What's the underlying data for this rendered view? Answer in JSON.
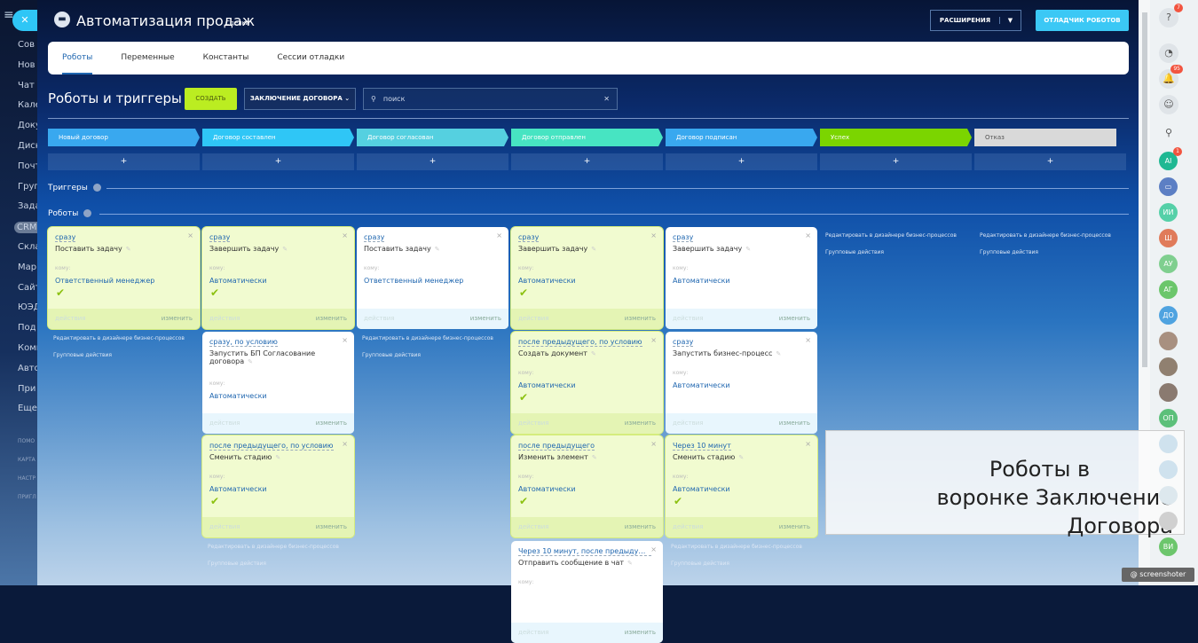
{
  "header": {
    "app_title": "Автоматизация продаж",
    "app_subtitle": "Сделки",
    "extensions_label": "РАСШИРЕНИЯ",
    "debug_label": "ОТЛАДЧИК РОБОТОВ"
  },
  "tabs": [
    "Роботы",
    "Переменные",
    "Константы",
    "Сессии отладки"
  ],
  "toolbar": {
    "title": "Роботы и триггеры",
    "create_label": "СОЗДАТЬ",
    "funnel_label": "ЗАКЛЮЧЕНИЕ ДОГОВОРА",
    "search_placeholder": "поиск"
  },
  "stages": [
    {
      "name": "Новый договор",
      "color": "#39a8ef"
    },
    {
      "name": "Договор составлен",
      "color": "#2fc6f6"
    },
    {
      "name": "Договор согласован",
      "color": "#55d0e0"
    },
    {
      "name": "Договор отправлен",
      "color": "#47e4c2"
    },
    {
      "name": "Договор подписан",
      "color": "#39a8ef"
    },
    {
      "name": "Успех",
      "color": "#7bd500"
    },
    {
      "name": "Отказ",
      "color": "#d9d9d9"
    }
  ],
  "add_label": "+",
  "sections": {
    "triggers": "Триггеры",
    "robots": "Роботы"
  },
  "card_labels": {
    "to": "кому:",
    "actions": "действия",
    "edit": "изменить"
  },
  "link_labels": {
    "designer": "Редактировать в дизайнере бизнес-процессов",
    "group": "Групповые действия"
  },
  "columns": [
    [
      {
        "when": "сразу",
        "name": "Поставить задачу",
        "who": "Ответственный менеджер",
        "ok": true
      }
    ],
    [
      {
        "when": "сразу",
        "name": "Завершить задачу",
        "who": "Автоматически",
        "ok": true
      },
      {
        "when": "сразу, по условию",
        "name": "Запустить БП Согласование договора",
        "who": "Автоматически",
        "ok": false
      },
      {
        "when": "после предыдущего, по условию",
        "name": "Сменить стадию",
        "who": "Автоматически",
        "ok": true
      }
    ],
    [
      {
        "when": "сразу",
        "name": "Поставить задачу",
        "who": "Ответственный менеджер",
        "ok": false
      }
    ],
    [
      {
        "when": "сразу",
        "name": "Завершить задачу",
        "who": "Автоматически",
        "ok": true
      },
      {
        "when": "после предыдущего, по условию",
        "name": "Создать документ",
        "who": "Автоматически",
        "ok": true
      },
      {
        "when": "после предыдущего",
        "name": "Изменить элемент",
        "who": "Автоматически",
        "ok": true
      },
      {
        "when": "Через 10 минут, после предыдущего...",
        "name": "Отправить сообщение в чат",
        "who": "",
        "ok": false
      }
    ],
    [
      {
        "when": "сразу",
        "name": "Завершить задачу",
        "who": "Автоматически",
        "ok": false
      },
      {
        "when": "сразу",
        "name": "Запустить бизнес-процесс",
        "who": "Автоматически",
        "ok": false
      },
      {
        "when": "Через 10 минут",
        "name": "Сменить стадию",
        "who": "Автоматически",
        "ok": true
      }
    ],
    [],
    []
  ],
  "left_menu": [
    "Сов",
    "Нов",
    "Чат",
    "Кале",
    "Доку",
    "Диск",
    "Почт",
    "Груп",
    "Зада",
    "CRM",
    "Скла",
    "Мар",
    "Сайт",
    "ЮЭД",
    "Под",
    "Комп",
    "Авто",
    "При",
    "Еще"
  ],
  "left_menu_small": [
    "ПОМО",
    "КАРТА",
    "НАСТР",
    "ПРИГЛ"
  ],
  "right_panel": {
    "help_badge": "7",
    "notif_badge": "95",
    "ai_badge": "1",
    "avatars": [
      {
        "t": "AI",
        "c": "#1fb893"
      },
      {
        "t": "ИИ",
        "c": "#55d0a8"
      },
      {
        "t": "Ш",
        "c": "#e07b5a"
      },
      {
        "t": "АУ",
        "c": "#7fcf8f"
      },
      {
        "t": "АГ",
        "c": "#6bc66b"
      },
      {
        "t": "ДО",
        "c": "#4fa3e0"
      },
      {
        "t": "",
        "c": "#a89080"
      },
      {
        "t": "",
        "c": "#908070"
      },
      {
        "t": "",
        "c": "#8a7a70"
      },
      {
        "t": "ОП",
        "c": "#5cc07a"
      },
      {
        "t": "",
        "c": "#cfe2ee"
      },
      {
        "t": "",
        "c": "#cfe2ee"
      },
      {
        "t": "",
        "c": "#dde8ee"
      },
      {
        "t": "",
        "c": "#d0d0d0"
      },
      {
        "t": "ВИ",
        "c": "#6cc66c"
      }
    ]
  },
  "overlay": {
    "line1": "Роботы в",
    "line2": "воронке Заключение Договора"
  },
  "watermark": "@ screenshoter"
}
